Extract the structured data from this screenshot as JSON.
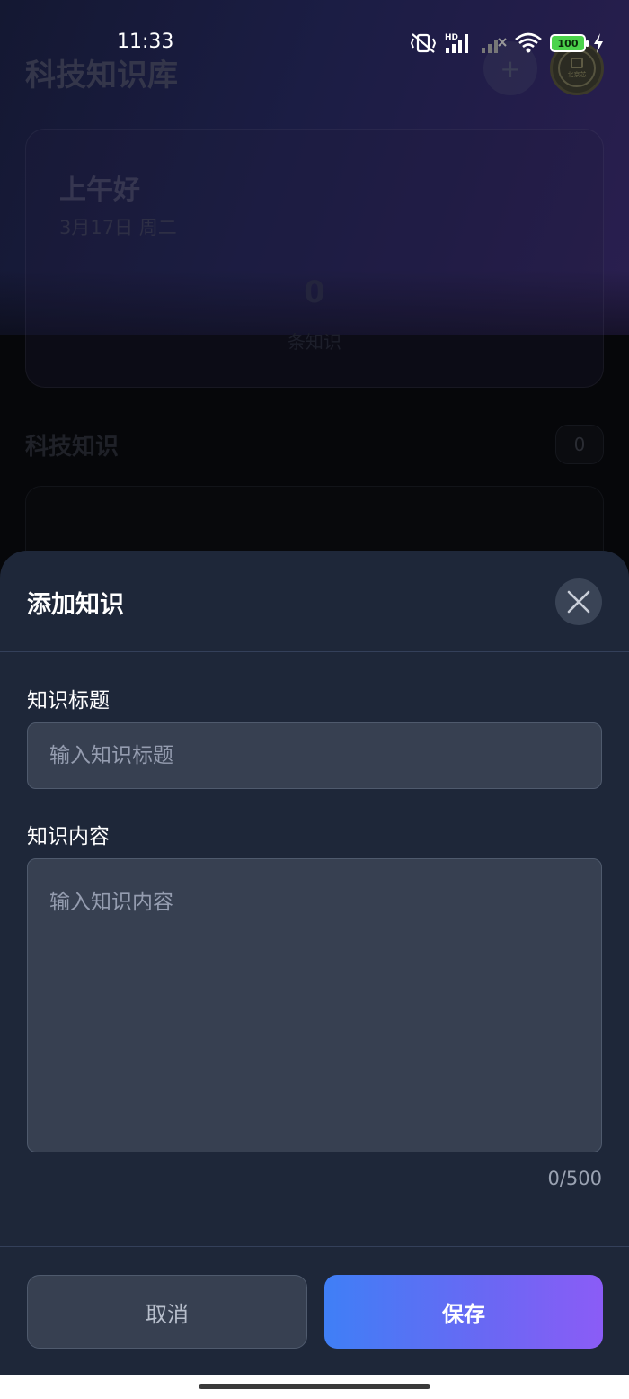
{
  "status_bar": {
    "time": "11:33",
    "battery": "100",
    "hd_label": "HD"
  },
  "background_page": {
    "app_title": "科技知识库",
    "add_icon": "+",
    "avatar_text": "北京芯",
    "greeting": "上午好",
    "date": "3月17日 周二",
    "knowledge_count": "0",
    "knowledge_count_label": "条知识",
    "section_title": "科技知识",
    "section_count": "0"
  },
  "sheet": {
    "title": "添加知识",
    "close_icon": "close-icon",
    "title_field": {
      "label": "知识标题",
      "value": "",
      "placeholder": "输入知识标题"
    },
    "content_field": {
      "label": "知识内容",
      "value": "",
      "placeholder": "输入知识内容"
    },
    "char_count": "0/500",
    "cancel_label": "取消",
    "save_label": "保存"
  },
  "colors": {
    "sheet_bg": "#1e2739",
    "input_bg": "#374051",
    "save_gradient_start": "#3f7ff6",
    "save_gradient_end": "#8b5cf6"
  }
}
